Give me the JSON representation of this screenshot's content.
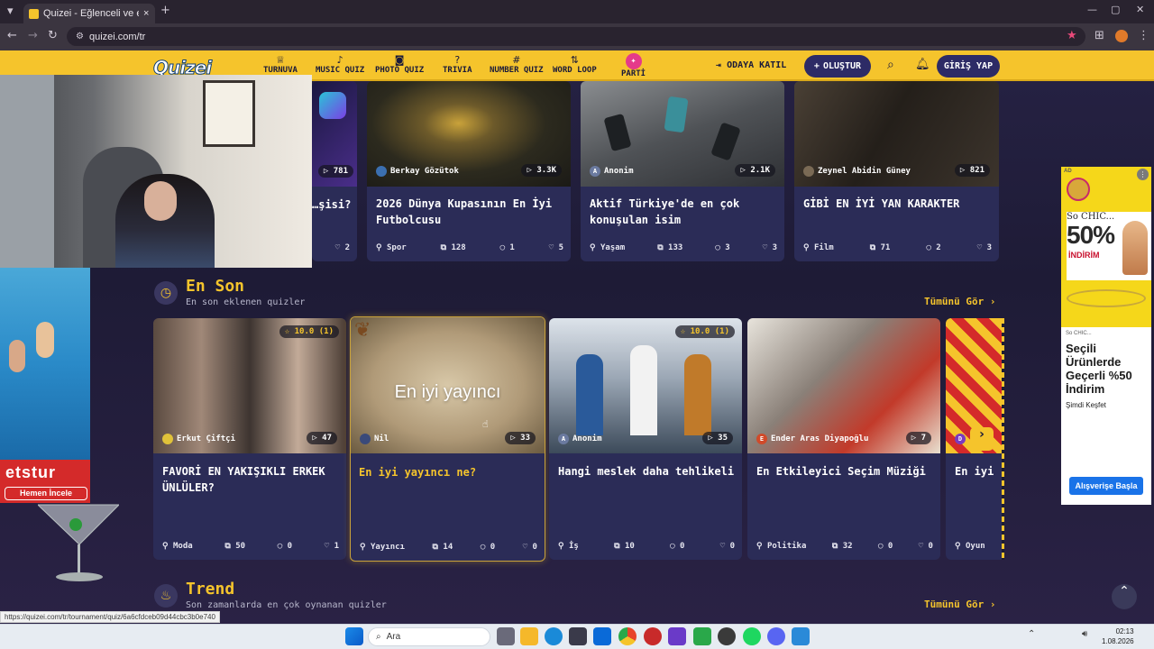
{
  "browser": {
    "tab_title": "Quizei - Eğlenceli ve etkileşimli",
    "url": "quizei.com/tr",
    "status_url": "https://quizei.com/tr/tournament/quiz/6a6cfdceb09d44cbc3b0e740",
    "tab_close": "×",
    "new_tab": "+"
  },
  "nav": {
    "logo": "Quizei",
    "items": [
      {
        "label": "TURNUVA",
        "icon": "trophy-icon"
      },
      {
        "label": "MUSIC QUIZ",
        "icon": "music-icon"
      },
      {
        "label": "PHOTO QUIZ",
        "icon": "camera-icon"
      },
      {
        "label": "TRIVIA",
        "icon": "trivia-icon"
      },
      {
        "label": "NUMBER QUIZ",
        "icon": "hash-icon"
      },
      {
        "label": "WORD LOOP",
        "icon": "sort-icon"
      },
      {
        "label": "PARTİ",
        "icon": "party-icon"
      }
    ],
    "join": "ODAYA KATIL",
    "create": "OLUŞTUR",
    "login": "GİRİŞ YAP"
  },
  "top_cards": [
    {
      "title": "…şisi?",
      "plays": "781",
      "likes": "2"
    },
    {
      "author": "Berkay Gözütok",
      "plays": "3.3K",
      "title": "2026 Dünya Kupasının En İyi Futbolcusu",
      "category": "Spor",
      "questions": "128",
      "comments": "1",
      "likes": "5"
    },
    {
      "author": "Anonim",
      "plays": "2.1K",
      "title": "Aktif Türkiye'de en çok konuşulan isim",
      "category": "Yaşam",
      "questions": "133",
      "comments": "3",
      "likes": "3"
    },
    {
      "author": "Zeynel Abidin Güney",
      "plays": "821",
      "title": "GİBİ EN İYİ YAN KARAKTER",
      "category": "Film",
      "questions": "71",
      "comments": "2",
      "likes": "3"
    }
  ],
  "en_son": {
    "title": "En Son",
    "subtitle": "En son eklenen quizler",
    "see_all": "Tümünü Gör ›",
    "cards": [
      {
        "rating": "10.0 (1)",
        "author": "Erkut Çiftçi",
        "plays": "47",
        "title": "FAVORİ EN YAKIŞIKLI ERKEK ÜNLÜLER?",
        "category": "Moda",
        "questions": "50",
        "comments": "0",
        "likes": "1"
      },
      {
        "image_text": "En iyi yayıncı",
        "author": "Nil",
        "plays": "33",
        "title": "En iyi yayıncı ne?",
        "category": "Yayıncı",
        "questions": "14",
        "comments": "0",
        "likes": "0"
      },
      {
        "rating": "10.0 (1)",
        "author": "Anonim",
        "plays": "35",
        "title": "Hangi meslek daha tehlikeli",
        "category": "İş",
        "questions": "10",
        "comments": "0",
        "likes": "0"
      },
      {
        "author": "Ender Aras Diyapoğlu",
        "plays": "7",
        "title": "En Etkileyici Seçim Müziği",
        "category": "Politika",
        "questions": "32",
        "comments": "0",
        "likes": "0"
      },
      {
        "author": "D",
        "title": "En iyi",
        "category": "Oyun"
      }
    ]
  },
  "trend": {
    "title": "Trend",
    "subtitle": "Son zamanlarda en çok oynanan quizler",
    "see_all": "Tümünü Gör ›"
  },
  "ads": {
    "left_brand": "etstur",
    "left_cta": "Hemen İncele",
    "right_label": "AD",
    "right_brand": "So CHIC...",
    "right_percent": "50%",
    "right_discount": "İNDİRİM",
    "right_small_brand": "So CHIC...",
    "right_headline": "Seçili Ürünlerde Geçerli %50 İndirim",
    "right_sub": "Şimdi Keşfet",
    "right_cta": "Alışverişe Başla"
  },
  "taskbar": {
    "search": "Ara",
    "time": "02:13",
    "date": "1.08.2026"
  },
  "colors": {
    "accent": "#f5c42c",
    "nav_dark": "#2d2b66",
    "card": "#2b2c57"
  }
}
